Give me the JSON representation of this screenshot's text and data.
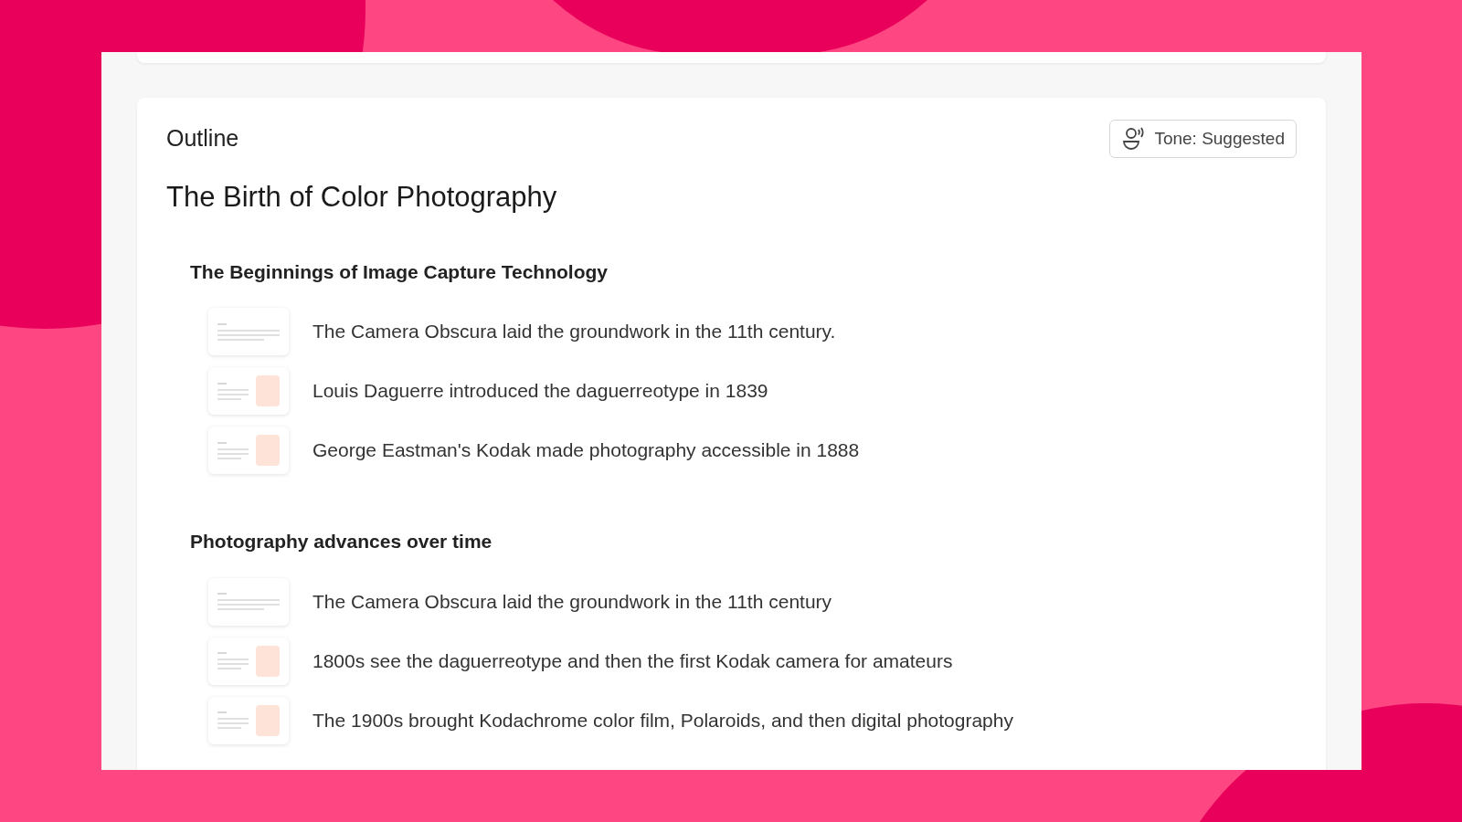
{
  "outline": {
    "label": "Outline",
    "tone_button": "Tone: Suggested",
    "title": "The Birth of Color Photography",
    "sections": [
      {
        "heading": "The Beginnings of Image Capture Technology",
        "items": [
          {
            "kind": "text",
            "text": "The Camera Obscura laid the groundwork in the 11th century."
          },
          {
            "kind": "image",
            "text": "Louis Daguerre introduced the daguerreotype in 1839"
          },
          {
            "kind": "image",
            "text": "George Eastman's Kodak made photography accessible in 1888"
          }
        ]
      },
      {
        "heading": "Photography advances over time",
        "items": [
          {
            "kind": "text",
            "text": "The Camera Obscura laid the groundwork in the 11th century"
          },
          {
            "kind": "image",
            "text": "1800s see the daguerreotype and then the first Kodak camera for amateurs"
          },
          {
            "kind": "image",
            "text": "The 1900s brought Kodachrome color film, Polaroids, and then digital photography"
          }
        ]
      }
    ]
  }
}
